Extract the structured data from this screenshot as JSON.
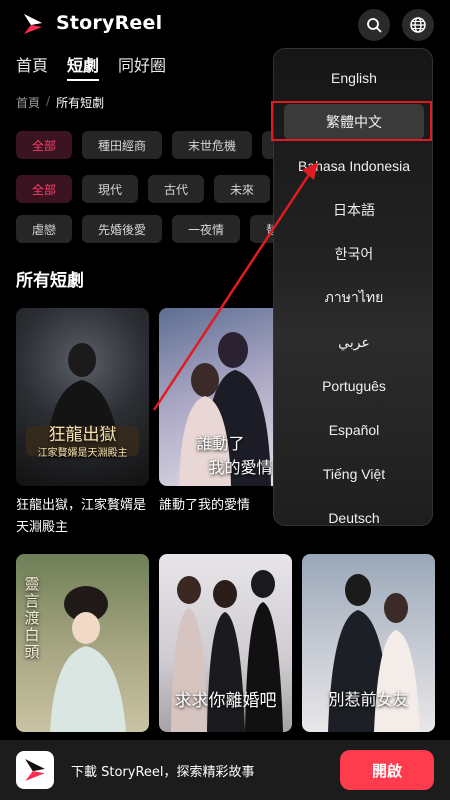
{
  "app": {
    "name": "StoryReel"
  },
  "nav": {
    "tabs": [
      "首頁",
      "短劇",
      "同好圈"
    ],
    "active": "短劇"
  },
  "breadcrumb": {
    "home": "首頁",
    "separator": "/",
    "current": "所有短劇"
  },
  "filters": {
    "row1": [
      "全部",
      "種田經商",
      "末世危機"
    ],
    "row2": [
      "全部",
      "現代",
      "古代",
      "未來"
    ],
    "row3": [
      "虐戀",
      "先婚後愛",
      "一夜情",
      "替"
    ]
  },
  "section": {
    "title": "所有短劇"
  },
  "cards": [
    {
      "title": "狂龍出獄，江家贅婿是天淵殿主",
      "poster_line1": "狂龍出獄",
      "poster_line2": "江家贅婿是天淵殿主"
    },
    {
      "title": "誰動了我的愛情",
      "poster_line1": "誰動了",
      "poster_line2": "我的愛情"
    },
    {
      "title": "",
      "poster_line1": "靈言渡白頭",
      "poster_line2": ""
    },
    {
      "title": "",
      "poster_line1": "求求你離婚吧",
      "poster_line2": ""
    },
    {
      "title": "",
      "poster_line1": "別惹前女友",
      "poster_line2": ""
    }
  ],
  "languages": [
    "English",
    "繁體中文",
    "Bahasa Indonesia",
    "日本語",
    "한국어",
    "ภาษาไทย",
    "عربي",
    "Português",
    "Español",
    "Tiếng Việt",
    "Deutsch"
  ],
  "selected_language": "繁體中文",
  "banner": {
    "text": "下載 StoryReel，探索精彩故事",
    "button": "開啟"
  },
  "colors": {
    "accent": "#ff3b4e",
    "chip_active_text": "#ff3d6b",
    "annotation": "#e01b24"
  },
  "icons": [
    "search-icon",
    "globe-icon",
    "storyreel-logo-icon"
  ]
}
